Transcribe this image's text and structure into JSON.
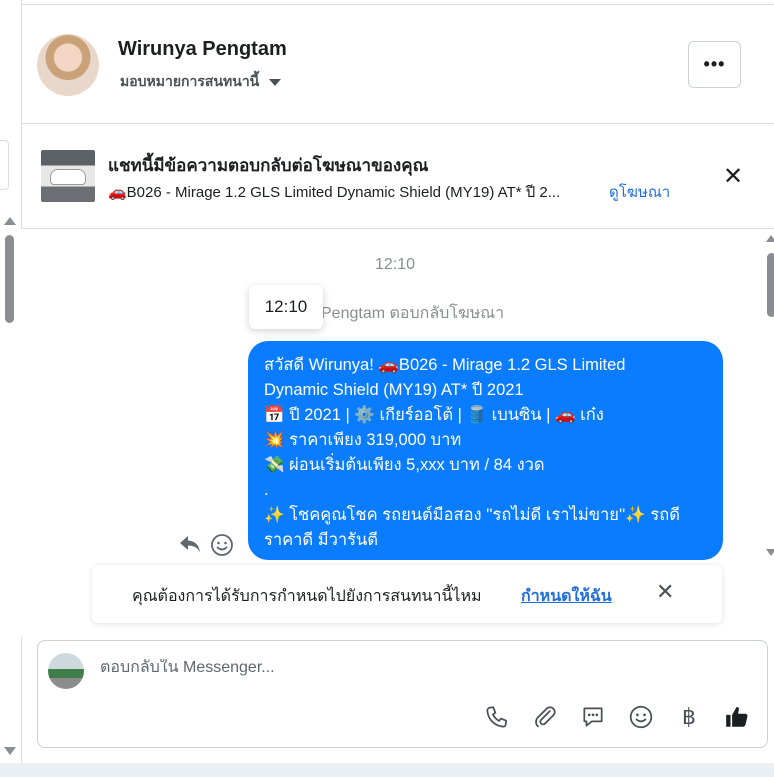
{
  "header": {
    "user_name": "Wirunya Pengtam",
    "assign_label": "มอบหมายการสนทนานี้",
    "more_label": "•••"
  },
  "ad_banner": {
    "title": "แชทนี้มีข้อความตอบกลับต่อโฆษณาของคุณ",
    "subtitle": "🚗B026 - Mirage 1.2 GLS Limited Dynamic Shield (MY19) AT* ปี 2...",
    "link": "ดูโฆษณา",
    "close": "✕"
  },
  "chat": {
    "timestamp": "12:10",
    "tooltip_time": "12:10",
    "reply_note": "Pengtam ตอบกลับโฆษณา",
    "message_lines": [
      "สวัสดี Wirunya! 🚗B026 - Mirage 1.2 GLS Limited",
      "Dynamic Shield (MY19) AT* ปี 2021",
      "📅 ปี 2021 | ⚙️ เกียร์ออโต้ | 🛢️ เบนซิน | 🚗 เก๋ง",
      "💥 ราคาเพียง 319,000 บาท",
      "💸 ผ่อนเริ่มต้นเพียง 5,xxx บาท / 84 งวด",
      ".",
      "✨ โชคคูณโชค รถยนต์มือสอง ''รถไม่ดี เราไม่ขาย''✨ รถดี",
      "ราคาดี มีวารันตี"
    ]
  },
  "assign_prompt": {
    "text": "คุณต้องการได้รับการกำหนดไปยังการสนทนานี้ไหม",
    "link": "กำหนดให้ฉัน",
    "close": "✕"
  },
  "composer": {
    "placeholder": "ตอบกลับใน Messenger...",
    "value": "",
    "baht_symbol": "฿",
    "icons": [
      "phone-icon",
      "attachment-icon",
      "saved-replies-icon",
      "emoji-icon",
      "baht-icon",
      "like-icon"
    ]
  },
  "colors": {
    "bubble": "#0a7cff",
    "link": "#216fdb"
  }
}
